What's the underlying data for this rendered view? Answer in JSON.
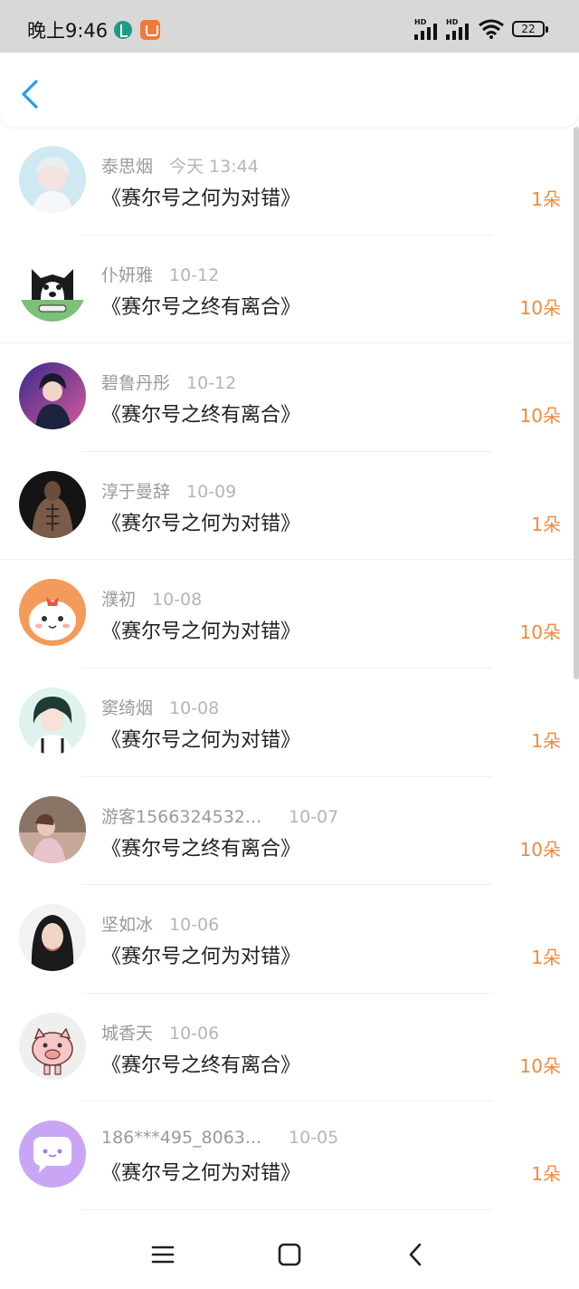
{
  "status": {
    "time": "晚上9:46",
    "battery": "22",
    "signal_label": "HD"
  },
  "header": {
    "back_icon": "chevron-left-icon"
  },
  "colors": {
    "accent": "#2b9af3",
    "amount": "#f08a3d",
    "name": "#9a9a9a"
  },
  "records": [
    {
      "name": "泰思烟",
      "date": "今天 13:44",
      "title": "《赛尔号之何为对错》",
      "amount": "1朵",
      "avatar": "girl-photo-avatar"
    },
    {
      "name": "仆妍雅",
      "date": "10-12",
      "title": "《赛尔号之终有离合》",
      "amount": "10朵",
      "avatar": "husky-cartoon-avatar"
    },
    {
      "name": "碧鲁丹彤",
      "date": "10-12",
      "title": "《赛尔号之终有离合》",
      "amount": "10朵",
      "avatar": "anime-boy-avatar"
    },
    {
      "name": "淳于曼辞",
      "date": "10-09",
      "title": "《赛尔号之何为对错》",
      "amount": "1朵",
      "avatar": "muscle-man-avatar"
    },
    {
      "name": "濮初",
      "date": "10-08",
      "title": "《赛尔号之何为对错》",
      "amount": "10朵",
      "avatar": "bunny-cartoon-avatar"
    },
    {
      "name": "窦绮烟",
      "date": "10-08",
      "title": "《赛尔号之何为对错》",
      "amount": "1朵",
      "avatar": "anime-girl-avatar"
    },
    {
      "name": "游客1566324532...",
      "date": "10-07",
      "title": "《赛尔号之终有离合》",
      "amount": "10朵",
      "avatar": "girl-scenery-avatar"
    },
    {
      "name": "坚如冰",
      "date": "10-06",
      "title": "《赛尔号之何为对错》",
      "amount": "1朵",
      "avatar": "woman-portrait-avatar"
    },
    {
      "name": "城香天",
      "date": "10-06",
      "title": "《赛尔号之终有离合》",
      "amount": "10朵",
      "avatar": "pig-cartoon-avatar"
    },
    {
      "name": "186***495_8063...",
      "date": "10-05",
      "title": "《赛尔号之何为对错》",
      "amount": "1朵",
      "avatar": "chat-bubble-avatar"
    }
  ],
  "navbar": {
    "menu_icon": "menu-icon",
    "home_icon": "home-icon",
    "back_icon": "back-icon"
  }
}
